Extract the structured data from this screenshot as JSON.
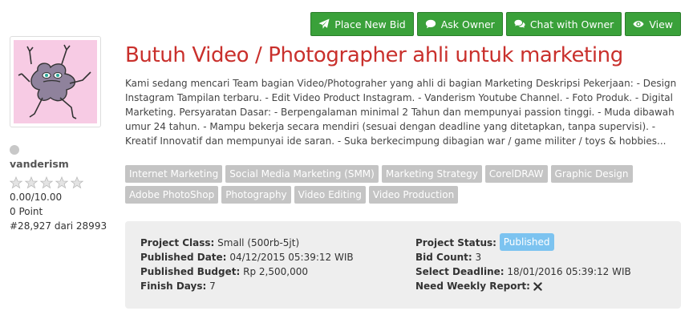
{
  "actions": {
    "place_bid": "Place New Bid",
    "ask_owner": "Ask Owner",
    "chat_owner": "Chat with Owner",
    "view": "View"
  },
  "owner": {
    "username": "vanderism",
    "rating": "0.00/10.00",
    "points": "0 Point",
    "rank": "#28,927 dari 28993",
    "stars_filled": 0,
    "stars_total": 5
  },
  "project": {
    "title": "Butuh Video / Photographer ahli untuk marketing",
    "description": "Kami sedang mencari Team bagian Video/Photograher yang ahli di bagian Marketing Deskripsi Pekerjaan: - Design Instagram Tampilan terbaru. - Edit Video Product Instagram. - Vanderism Youtube Channel. - Foto Produk. - Digital Marketing. Persyaratan Dasar: - Berpengalaman minimal 2 Tahun dan mempunyai passion tinggi. - Muda dibawah umur 24 tahun. - Mampu bekerja secara mendiri (sesuai dengan deadline yang ditetapkan, tanpa supervisi). - Kreatif Innovatif dan mempunyai ide saran. - Suka berkecimpung dibagian war / game militer / toys & hobbies...",
    "tags": [
      "Internet Marketing",
      "Social Media Marketing (SMM)",
      "Marketing Strategy",
      "CorelDRAW",
      "Graphic Design",
      "Adobe PhotoShop",
      "Photography",
      "Video Editing",
      "Video Production"
    ]
  },
  "details": {
    "class_label": "Project Class:",
    "class_value": "Small (500rb-5jt)",
    "published_date_label": "Published Date:",
    "published_date_value": "04/12/2015 05:39:12 WIB",
    "budget_label": "Published Budget:",
    "budget_value": "Rp 2,500,000",
    "finish_days_label": "Finish Days:",
    "finish_days_value": "7",
    "status_label": "Project Status:",
    "status_value": "Published",
    "bid_count_label": "Bid Count:",
    "bid_count_value": "3",
    "deadline_label": "Select Deadline:",
    "deadline_value": "18/01/2016 05:39:12 WIB",
    "weekly_report_label": "Need Weekly Report:",
    "weekly_report_value": false
  },
  "colors": {
    "button_green": "#3aa13a",
    "title_red": "#c9302c",
    "tag_gray": "#c4c4c4",
    "status_blue": "#7cc3f0",
    "panel_gray": "#eeeeee",
    "avatar_pink": "#f7cbe4"
  },
  "icons": [
    "paper-plane-icon",
    "comment-icon",
    "comments-icon",
    "eye-icon",
    "star-icon",
    "times-icon"
  ]
}
